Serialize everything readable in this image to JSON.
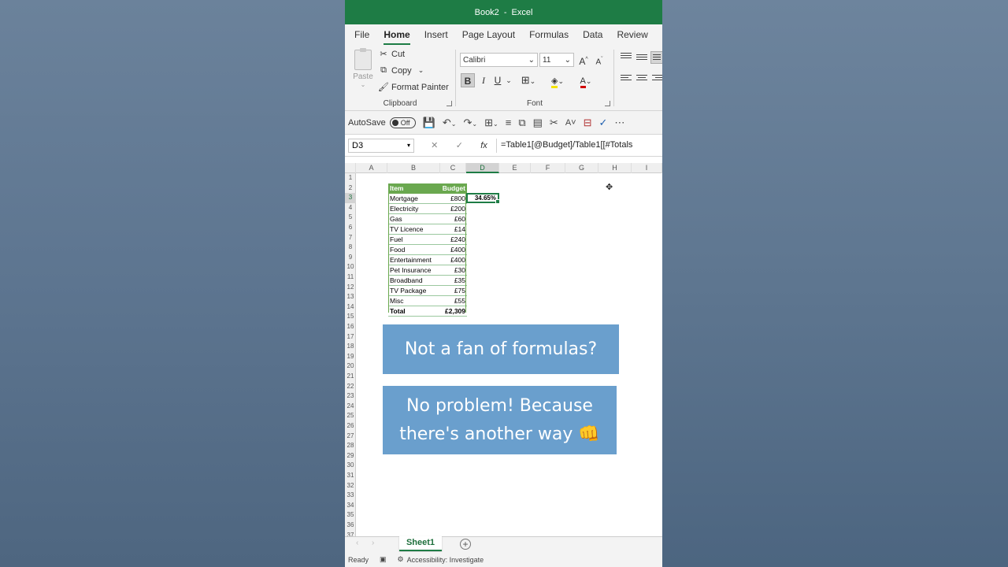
{
  "window": {
    "doc_name": "Book2",
    "separator": "-",
    "app_name": "Excel"
  },
  "tabs": [
    "File",
    "Home",
    "Insert",
    "Page Layout",
    "Formulas",
    "Data",
    "Review"
  ],
  "active_tab": "Home",
  "clipboard": {
    "paste_label": "Paste",
    "cut_label": "Cut",
    "copy_label": "Copy",
    "format_painter_label": "Format Painter",
    "group_label": "Clipboard"
  },
  "font_group": {
    "font_name": "Calibri",
    "font_size": "11",
    "grow_label": "A",
    "shrink_label": "A",
    "bold": "B",
    "italic": "I",
    "underline": "U",
    "group_label": "Font"
  },
  "qat": {
    "autosave_label": "AutoSave",
    "autosave_state": "Off"
  },
  "formula_bar": {
    "name_box": "D3",
    "formula": "=Table1[@Budget]/Table1[[#Totals"
  },
  "columns": [
    "A",
    "B",
    "C",
    "D",
    "E",
    "F",
    "G",
    "H",
    "I"
  ],
  "selected_column": "D",
  "rows": [
    "1",
    "2",
    "3",
    "4",
    "5",
    "6",
    "7",
    "8",
    "9",
    "10",
    "11",
    "12",
    "13",
    "14",
    "15",
    "16",
    "17",
    "18",
    "19",
    "20",
    "21",
    "22",
    "23",
    "24",
    "25",
    "26",
    "27",
    "28",
    "29",
    "30",
    "31",
    "32",
    "33",
    "34",
    "35",
    "36",
    "37"
  ],
  "selected_row": "3",
  "table": {
    "headers": [
      "Item",
      "Budget"
    ],
    "rows": [
      [
        "Mortgage",
        "£800"
      ],
      [
        "Electricity",
        "£200"
      ],
      [
        "Gas",
        "£60"
      ],
      [
        "TV Licence",
        "£14"
      ],
      [
        "Fuel",
        "£240"
      ],
      [
        "Food",
        "£400"
      ],
      [
        "Entertainment",
        "£400"
      ],
      [
        "Pet Insurance",
        "£30"
      ],
      [
        "Broadband",
        "£35"
      ],
      [
        "TV Package",
        "£75"
      ],
      [
        "Misc",
        "£55"
      ]
    ],
    "total": [
      "Total",
      "£2,309"
    ]
  },
  "selected_cell_value": "34.65%",
  "callouts": {
    "first": "Not a fan of formulas?",
    "second_line1": "No problem! Because",
    "second_line2": "there's another way 👊"
  },
  "sheet_tab": "Sheet1",
  "status": {
    "ready": "Ready",
    "accessibility": "Accessibility: Investigate"
  },
  "colors": {
    "excel_green": "#1e7c45",
    "table_header": "#6aa84f",
    "callout_bg": "#6a9fcd"
  }
}
